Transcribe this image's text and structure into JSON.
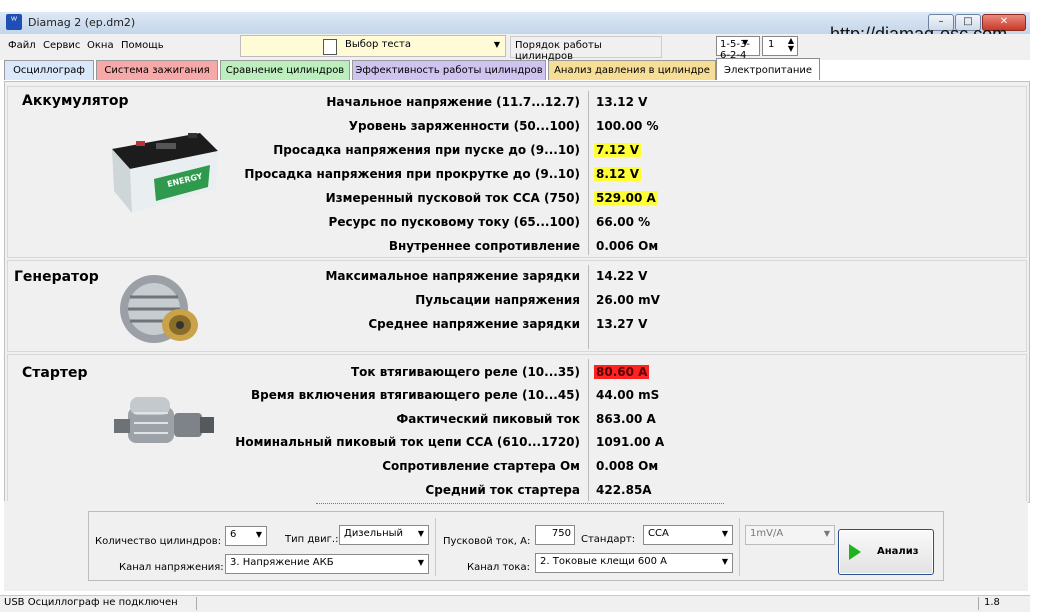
{
  "window": {
    "title": "Diamag 2 (ep.dm2)",
    "app_icon": "app-icon",
    "minimize": "–",
    "maximize": "□",
    "close": "✕",
    "website": "http://diamag-osc.com"
  },
  "menu": [
    "Файл",
    "Сервис",
    "Окна",
    "Помощь"
  ],
  "toolbar": {
    "test_select": "Выбор теста",
    "order_label": "Порядок работы цилиндров",
    "order_value": "1-5-3-6-2-4",
    "spin_value": "1"
  },
  "tabs": [
    {
      "label": "Осциллограф",
      "color": "#d9e8fa"
    },
    {
      "label": "Система зажигания",
      "color": "#f7a8a8"
    },
    {
      "label": "Сравнение цилиндров",
      "color": "#bdeebd"
    },
    {
      "label": "Эффективность работы цилиндров",
      "color": "#cfc4f0"
    },
    {
      "label": "Анализ давления в цилиндре",
      "color": "#f7de96"
    },
    {
      "label": "Электропитание",
      "color": "#ffffff"
    }
  ],
  "battery": {
    "title": "Аккумулятор",
    "rows": [
      {
        "label": "Начальное напряжение (11.7...12.7)",
        "value": "13.12 V"
      },
      {
        "label": "Уровень заряженности (50...100)",
        "value": "100.00 %"
      },
      {
        "label": "Просадка напряжения при пуске до (9...10)",
        "value": "7.12 V"
      },
      {
        "label": "Просадка напряжения при прокрутке до  (9..10)",
        "value": "8.12 V"
      },
      {
        "label": "Измеренный пусковой ток  CCA (750)",
        "value": "529.00 A"
      },
      {
        "label": "Ресурс по пусковому току (65...100)",
        "value": "66.00 %"
      },
      {
        "label": "Внутреннее сопротивление",
        "value": "0.006 Ом"
      }
    ]
  },
  "generator": {
    "title": "Генератор",
    "rows": [
      {
        "label": "Максимальное напряжение зарядки",
        "value": "14.22 V"
      },
      {
        "label": "Пульсации напряжения",
        "value": "26.00 mV"
      },
      {
        "label": "Среднее напряжение зарядки",
        "value": "13.27 V"
      }
    ]
  },
  "starter": {
    "title": "Стартер",
    "rows": [
      {
        "label": "Ток втягивающего реле (10...35)",
        "value": "80.60 A"
      },
      {
        "label": "Время включения втягивающего реле (10...45)",
        "value": "44.00 mS"
      },
      {
        "label": "Фактический пиковый ток",
        "value": "863.00 A"
      },
      {
        "label": "Номинальный пиковый ток цепи CCA (610...1720)",
        "value": "1091.00 A"
      },
      {
        "label": "Сопротивление стартера Ом",
        "value": "0.008 Ом"
      },
      {
        "label": "Средний ток стартера",
        "value": "422.85A"
      }
    ]
  },
  "controls": {
    "cyl_count_label": "Количество цилиндров:",
    "cyl_count": "6",
    "engine_type_label": "Тип двиг.:",
    "engine_type": "Дизельный",
    "voltage_channel_label": "Канал напряжения:",
    "voltage_channel": "3.  Напряжение АКБ",
    "start_current_label": "Пусковой ток, А:",
    "start_current": "750",
    "standard_label": "Стандарт:",
    "standard": "CCA",
    "current_channel_label": "Канал тока:",
    "current_channel": "2.  Токовые клещи 600 А",
    "sensitivity": "1mV/A",
    "analyze": "Анализ"
  },
  "status": {
    "text": "USB Осциллограф не подключен",
    "version": "1.8"
  }
}
